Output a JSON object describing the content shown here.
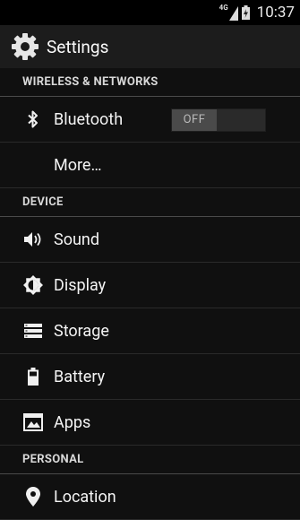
{
  "status_bar": {
    "network": "4G",
    "time": "10:37"
  },
  "action_bar": {
    "title": "Settings",
    "icon": "settings-gear-icon"
  },
  "sections": {
    "wireless": {
      "header": "WIRELESS & NETWORKS",
      "bluetooth": {
        "label": "Bluetooth",
        "toggle": "OFF",
        "icon": "bluetooth-icon"
      },
      "more": {
        "label": "More…"
      }
    },
    "device": {
      "header": "DEVICE",
      "sound": {
        "label": "Sound",
        "icon": "speaker-icon"
      },
      "display": {
        "label": "Display",
        "icon": "brightness-icon"
      },
      "storage": {
        "label": "Storage",
        "icon": "storage-icon"
      },
      "battery": {
        "label": "Battery",
        "icon": "battery-icon"
      },
      "apps": {
        "label": "Apps",
        "icon": "apps-icon"
      }
    },
    "personal": {
      "header": "PERSONAL",
      "location": {
        "label": "Location",
        "icon": "location-pin-icon"
      }
    }
  }
}
